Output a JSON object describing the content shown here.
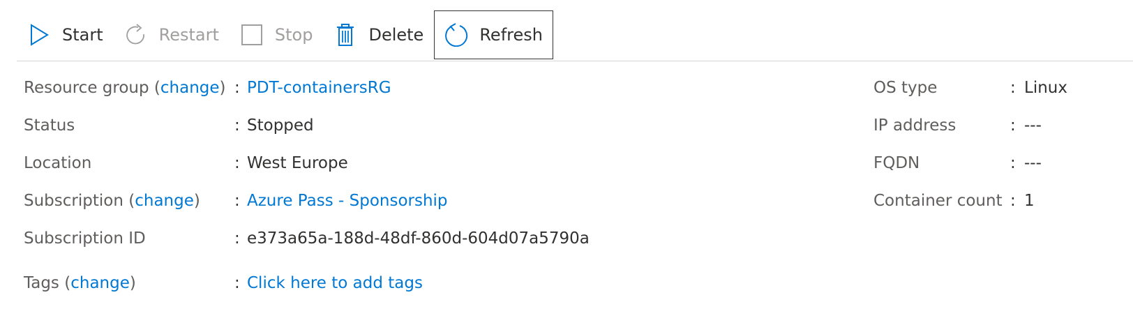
{
  "toolbar": {
    "start": {
      "label": "Start",
      "icon": "play-icon"
    },
    "restart": {
      "label": "Restart",
      "icon": "restart-icon"
    },
    "stop": {
      "label": "Stop",
      "icon": "stop-icon"
    },
    "delete": {
      "label": "Delete",
      "icon": "trash-icon"
    },
    "refresh": {
      "label": "Refresh",
      "icon": "refresh-icon"
    }
  },
  "colors": {
    "link": "#0078d4",
    "icon_blue": "#0078d4",
    "disabled": "#a19f9d"
  },
  "essentials": {
    "left": [
      {
        "key": "Resource group",
        "change": "change",
        "value": "PDT-containersRG",
        "value_is_link": true
      },
      {
        "key": "Status",
        "value": "Stopped"
      },
      {
        "key": "Location",
        "value": "West Europe"
      },
      {
        "key": "Subscription",
        "change": "change",
        "value": "Azure Pass - Sponsorship",
        "value_is_link": true
      },
      {
        "key": "Subscription ID",
        "value": "e373a65a-188d-48df-860d-604d07a5790a"
      },
      {
        "key": "Tags",
        "change": "change",
        "value": "Click here to add tags",
        "value_is_link": true
      }
    ],
    "right": [
      {
        "key": "OS type",
        "value": "Linux"
      },
      {
        "key": "IP address",
        "value": "---"
      },
      {
        "key": "FQDN",
        "value": "---"
      },
      {
        "key": "Container count",
        "value": "1"
      }
    ],
    "separator": ":"
  }
}
